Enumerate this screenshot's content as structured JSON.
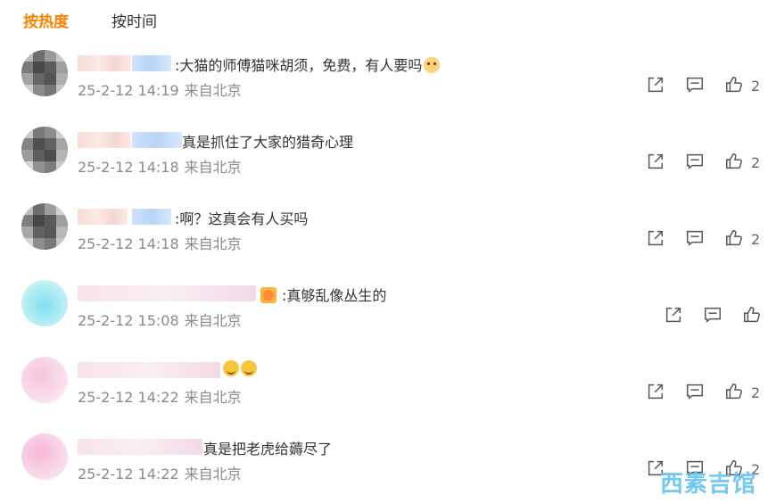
{
  "sort": {
    "hot_label": "按热度",
    "time_label": "按时间"
  },
  "comments": [
    {
      "text": ":大猫的师傅猫咪胡须，免费，有人要吗",
      "emoji": "cat-face-icon",
      "date": "25-2-12 14:19",
      "location": "来自北京",
      "likes": "2"
    },
    {
      "text": "真是抓住了大家的猎奇心理",
      "emoji": "",
      "date": "25-2-12 14:18",
      "location": "来自北京",
      "likes": "2"
    },
    {
      "text": ":啊？这真会有人买吗",
      "emoji": "",
      "date": "25-2-12 14:18",
      "location": "来自北京",
      "likes": "2"
    },
    {
      "text": ":真够乱像丛生的",
      "emoji": "crown-emoji-icon",
      "date": "25-2-12 15:08",
      "location": "来自北京",
      "likes": ""
    },
    {
      "text": "",
      "emoji": "smile-emoji-icon",
      "date": "25-2-12 14:22",
      "location": "来自北京",
      "likes": "2"
    },
    {
      "text": "真是把老虎给薅尽了",
      "emoji": "",
      "date": "25-2-12 14:22",
      "location": "来自北京",
      "likes": "2"
    }
  ],
  "watermark": "西素吉馆",
  "icons": {
    "share": "share-icon",
    "comment": "comment-icon",
    "like": "thumbs-up-icon"
  },
  "colors": {
    "accent": "#ff8200",
    "meta_gray": "#8a8a8a",
    "text": "#333333"
  }
}
